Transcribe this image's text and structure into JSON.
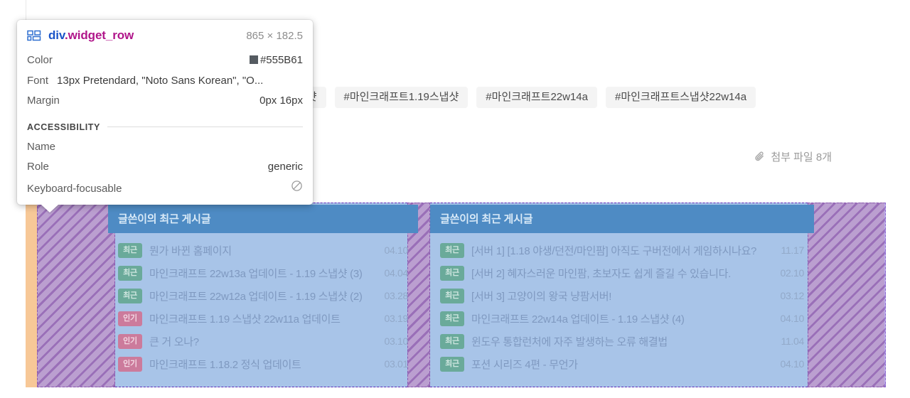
{
  "inspector": {
    "icon": "layout-grid-icon",
    "element_tag": "div",
    "element_class": ".widget_row",
    "dimensions": "865 × 182.5",
    "properties": [
      {
        "key": "Color",
        "value": "#555B61",
        "swatch": "#555B61"
      },
      {
        "key": "Font",
        "value": "13px Pretendard, \"Noto Sans Korean\", \"O..."
      },
      {
        "key": "Margin",
        "value": "0px 16px"
      }
    ],
    "accessibility": {
      "section_label": "ACCESSIBILITY",
      "rows": [
        {
          "key": "Name",
          "value": ""
        },
        {
          "key": "Role",
          "value": "generic"
        },
        {
          "key": "Keyboard-focusable",
          "value": "",
          "icon": "not-allowed-icon"
        }
      ]
    }
  },
  "page": {
    "tags": [
      "#마인크래프트스냅샷",
      "#마인크래프트1.19스냅샷",
      "#마인크래프트22w14a",
      "#마인크래프트스냅샷22w14a"
    ],
    "attachment": {
      "icon": "paperclip-icon",
      "label": "첨부 파일 8개"
    },
    "widgets": [
      {
        "title": "글쓴이의 최근 게시글",
        "rows": [
          {
            "badge": "최근",
            "badge_type": "recent",
            "title": "뭔가 바뀐 홈페이지",
            "date": "04.10"
          },
          {
            "badge": "최근",
            "badge_type": "recent",
            "title": "마인크래프트 22w13a 업데이트 - 1.19 스냅샷 (3)",
            "date": "04.04"
          },
          {
            "badge": "최근",
            "badge_type": "recent",
            "title": "마인크래프트 22w12a 업데이트 - 1.19 스냅샷 (2)",
            "date": "03.28"
          },
          {
            "badge": "인기",
            "badge_type": "hot",
            "title": "마인크래프트 1.19 스냅샷 22w11a 업데이트",
            "date": "03.19"
          },
          {
            "badge": "인기",
            "badge_type": "hot",
            "title": "큰 거 오나?",
            "date": "03.10"
          },
          {
            "badge": "인기",
            "badge_type": "hot",
            "title": "마인크래프트 1.18.2 정식 업데이트",
            "date": "03.01"
          }
        ]
      },
      {
        "title": "글쓴이의 최근 게시글",
        "rows": [
          {
            "badge": "최근",
            "badge_type": "recent",
            "title": "[서버 1] [1.18 야생/던전/마인팜] 아직도 구버전에서 게임하시나요?",
            "date": "11.17"
          },
          {
            "badge": "최근",
            "badge_type": "recent",
            "title": "[서버 2] 혜자스러운 마인팜, 초보자도 쉽게 즐길 수 있습니다.",
            "date": "02.10"
          },
          {
            "badge": "최근",
            "badge_type": "recent",
            "title": "[서버 3] 고양이의 왕국 냥팜서버!",
            "date": "03.12"
          },
          {
            "badge": "최근",
            "badge_type": "recent",
            "title": "마인크래프트 22w14a 업데이트 - 1.19 스냅샷 (4)",
            "date": "04.10"
          },
          {
            "badge": "최근",
            "badge_type": "recent",
            "title": "윈도우 통합런처에 자주 발생하는 오류 해결법",
            "date": "11.04"
          },
          {
            "badge": "최근",
            "badge_type": "recent",
            "title": "포션 시리즈 4편 - 무언가",
            "date": "04.10"
          }
        ]
      }
    ]
  },
  "highlight": {
    "margin_color": "#F7C897",
    "padding_color": "#A490E6",
    "content_color": "#A8C4E8",
    "border_color": "#5F29B8"
  }
}
